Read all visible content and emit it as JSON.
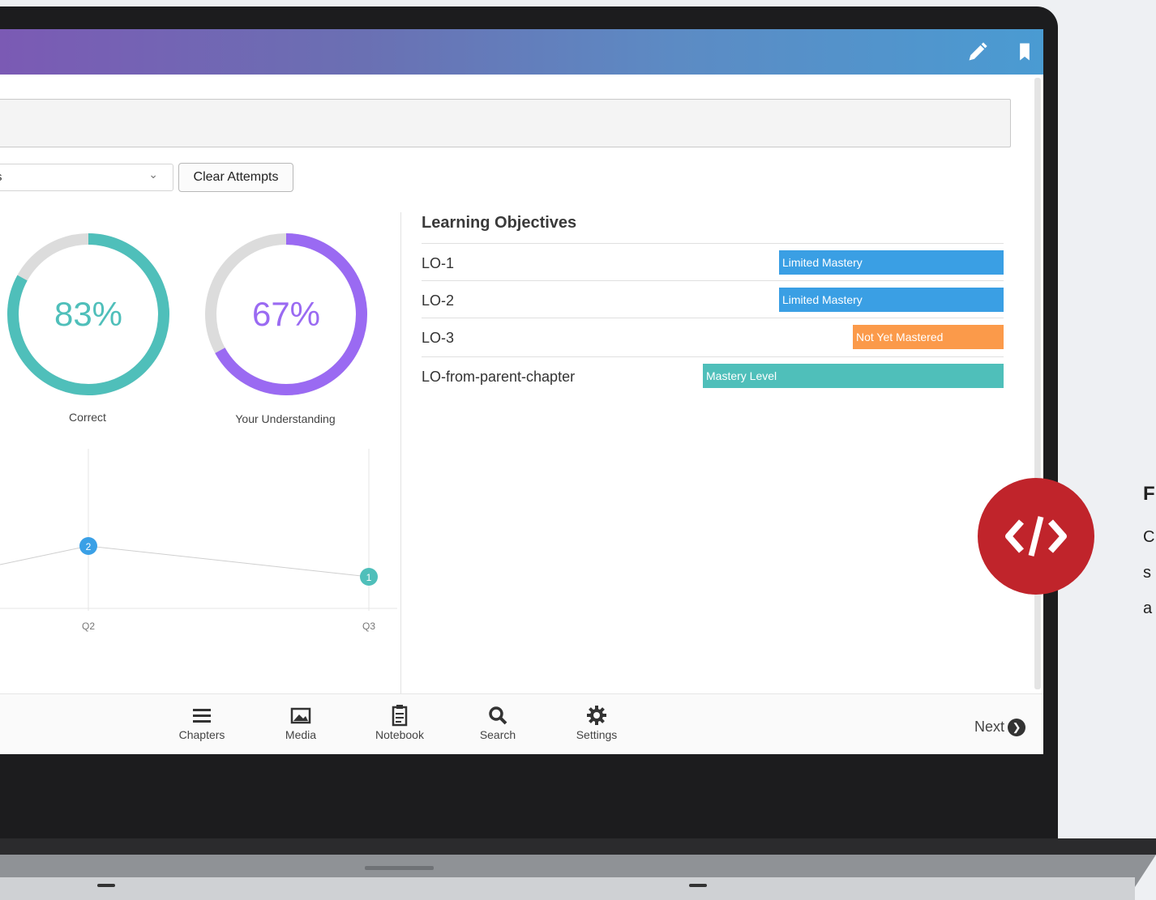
{
  "toolbar": {
    "edit_icon": "pencil-icon",
    "bookmark_icon": "bookmark-icon"
  },
  "filters": {
    "select_value": "s",
    "clear_label": "Clear Attempts"
  },
  "donuts": [
    {
      "value": "83%",
      "label": "Correct",
      "fraction": 0.83,
      "color": "#4fbfba"
    },
    {
      "value": "67%",
      "label": "Your Understanding",
      "fraction": 0.67,
      "color": "#9a6af2"
    }
  ],
  "attempts_chart": {
    "points": [
      {
        "q": "Q2",
        "count": "2",
        "color": "#3aa0e6"
      },
      {
        "q": "Q3",
        "count": "1",
        "color": "#4fbfba"
      }
    ]
  },
  "learning_objectives": {
    "title": "Learning Objectives",
    "items": [
      {
        "name": "LO-1",
        "status": "Limited Mastery",
        "color": "#3a9fe4"
      },
      {
        "name": "LO-2",
        "status": "Limited Mastery",
        "color": "#3a9fe4"
      },
      {
        "name": "LO-3",
        "status": "Not Yet Mastered",
        "color": "#fb9a4a"
      },
      {
        "name": "LO-from-parent-chapter",
        "status": "Mastery Level",
        "color": "#4fbfba"
      }
    ]
  },
  "nav": {
    "items": [
      {
        "label": "Chapters",
        "icon": "menu-icon"
      },
      {
        "label": "Media",
        "icon": "image-icon"
      },
      {
        "label": "Notebook",
        "icon": "clipboard-icon"
      },
      {
        "label": "Search",
        "icon": "search-icon"
      },
      {
        "label": "Settings",
        "icon": "gear-icon"
      }
    ],
    "next_label": "Next"
  },
  "side": {
    "heading_fragment": "F",
    "line1": "C",
    "line2": "s",
    "line3": "a"
  }
}
